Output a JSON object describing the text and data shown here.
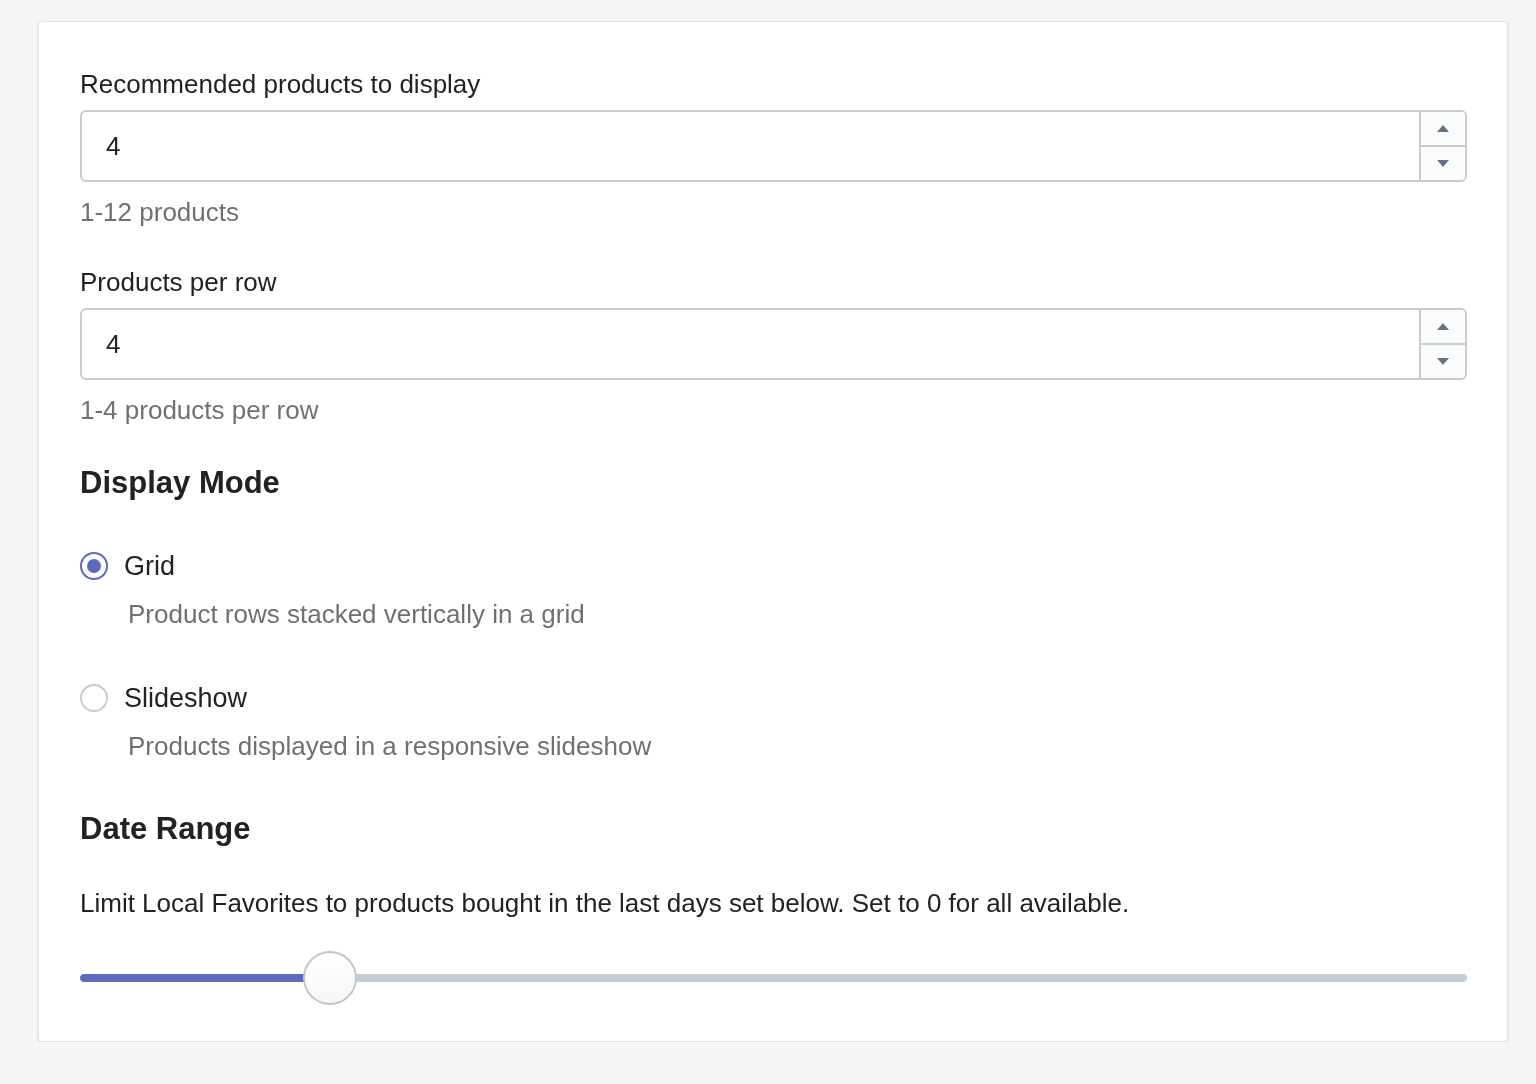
{
  "fields": [
    {
      "label": "Recommended products to display",
      "value": "4",
      "help": "1-12 products"
    },
    {
      "label": "Products per row",
      "value": "4",
      "help": "1-4 products per row"
    }
  ],
  "display_mode": {
    "heading": "Display Mode",
    "options": [
      {
        "label": "Grid",
        "description": "Product rows stacked vertically in a grid",
        "selected": true
      },
      {
        "label": "Slideshow",
        "description": "Products displayed in a responsive slideshow",
        "selected": false
      }
    ]
  },
  "date_range": {
    "heading": "Date Range",
    "description": "Limit Local Favorites to products bought in the last days set below. Set to 0 for all available.",
    "level": 0.18
  }
}
